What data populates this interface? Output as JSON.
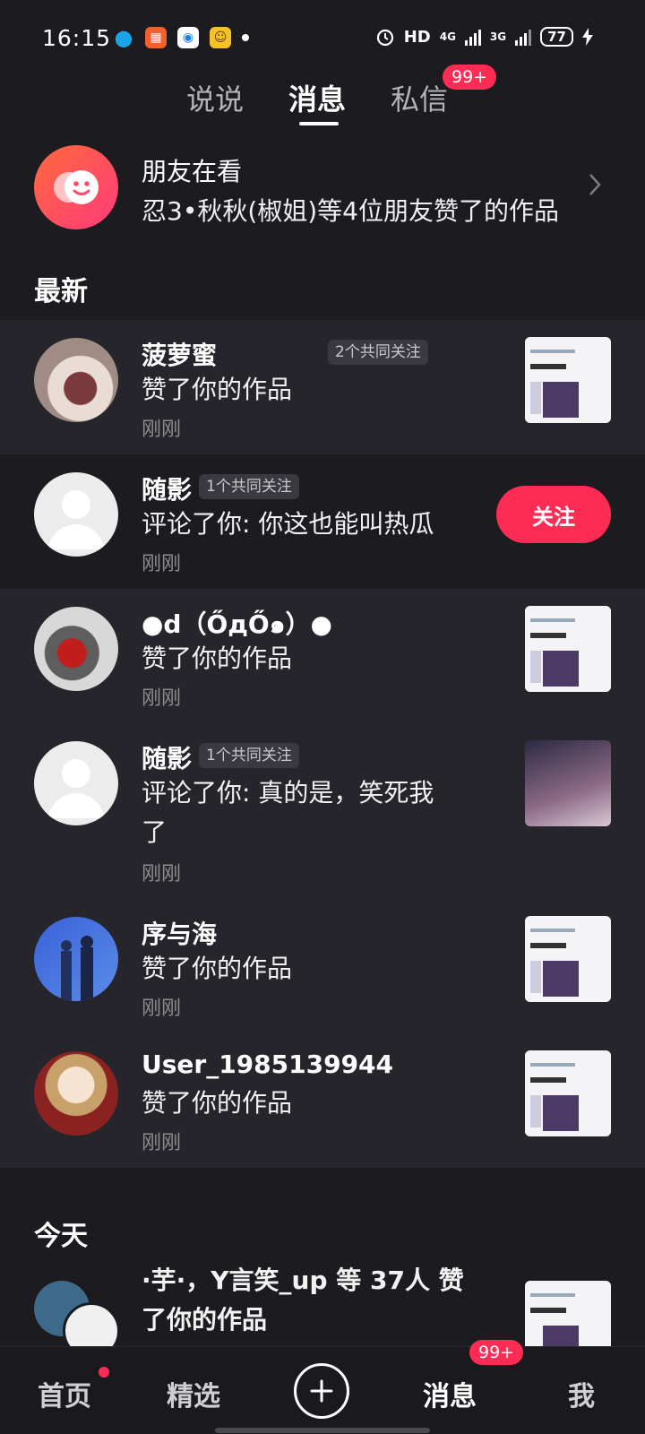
{
  "status_bar": {
    "time": "16:15",
    "hd_label": "HD",
    "net1": "4G",
    "net2": "3G",
    "battery": "77"
  },
  "top_tabs": {
    "tab1": "说说",
    "tab2": "消息",
    "tab3": "私信",
    "tab3_badge": "99+"
  },
  "friends": {
    "title": "朋友在看",
    "subtitle": "忍3•秋秋(椒姐)等4位朋友赞了的作品"
  },
  "sections": {
    "latest": "最新",
    "today": "今天"
  },
  "items": [
    {
      "name": "菠萝蜜",
      "mutual": "2个共同关注",
      "action": "赞了你的作品",
      "time": "刚刚"
    },
    {
      "name": "随影",
      "mutual": "1个共同关注",
      "action": "评论了你: 你这也能叫热瓜",
      "time": "刚刚",
      "button": "关注"
    },
    {
      "name": "●d（ŐдŐ๑）●",
      "action": "赞了你的作品",
      "time": "刚刚"
    },
    {
      "name": "随影",
      "mutual": "1个共同关注",
      "action": "评论了你: 真的是，笑死我了",
      "time": "刚刚"
    },
    {
      "name": "序与海",
      "action": "赞了你的作品",
      "time": "刚刚"
    },
    {
      "name": "User_1985139944",
      "action": "赞了你的作品",
      "time": "刚刚"
    },
    {
      "name": "·芋·，Y言笑_up 等 37人 赞了你的作品"
    }
  ],
  "bottom_nav": {
    "home": "首页",
    "featured": "精选",
    "messages": "消息",
    "messages_badge": "99+",
    "me": "我"
  },
  "colors": {
    "background": "#1c1b20",
    "accent": "#fe2c55",
    "highlight_row": "#26252b"
  }
}
